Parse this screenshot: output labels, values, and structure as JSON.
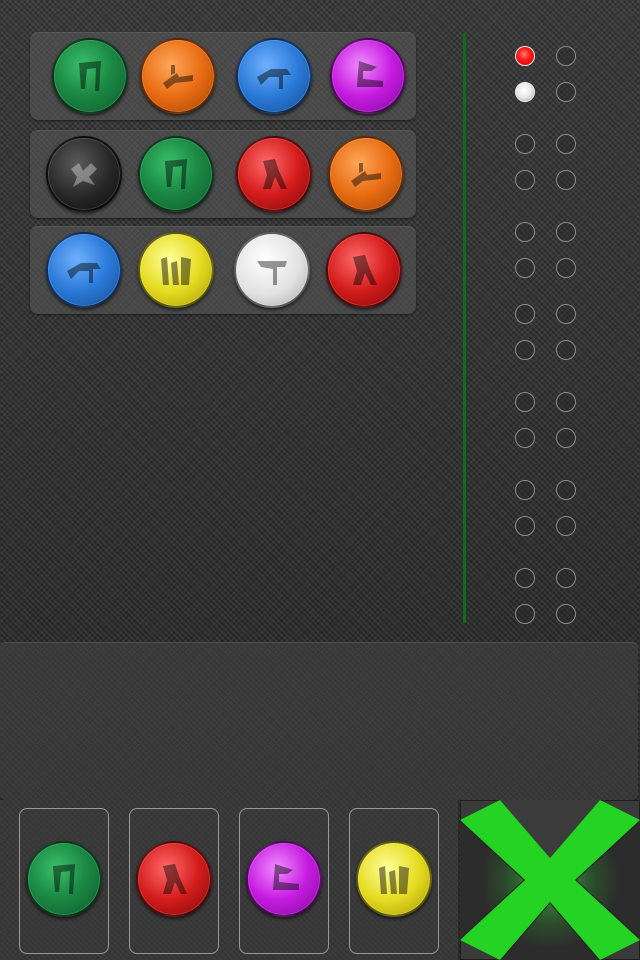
{
  "colors": {
    "green": "#1c8a45",
    "orange": "#e86c12",
    "blue": "#2a7ad8",
    "purple": "#c51be0",
    "black": "#262626",
    "red": "#d41c1c",
    "yellow": "#e6dc22",
    "white": "#e2e2e2",
    "divider": "#0b6e16",
    "clear_x": "#22ee22"
  },
  "guess_rows": [
    {
      "balls": [
        {
          "color": "green",
          "symbol": "glyph-green-icon"
        },
        {
          "color": "orange",
          "symbol": "glyph-orange-icon"
        },
        {
          "color": "blue",
          "symbol": "glyph-blue-icon"
        },
        {
          "color": "purple",
          "symbol": "glyph-purple-icon"
        }
      ]
    },
    {
      "balls": [
        {
          "color": "black",
          "symbol": "glyph-black-icon"
        },
        {
          "color": "green",
          "symbol": "glyph-green-icon"
        },
        {
          "color": "red",
          "symbol": "glyph-red-icon"
        },
        {
          "color": "orange",
          "symbol": "glyph-orange-icon"
        }
      ]
    },
    {
      "balls": [
        {
          "color": "blue",
          "symbol": "glyph-blue-icon"
        },
        {
          "color": "yellow",
          "symbol": "glyph-yellow-icon"
        },
        {
          "color": "white",
          "symbol": "glyph-white-icon"
        },
        {
          "color": "red",
          "symbol": "glyph-red-icon"
        }
      ]
    }
  ],
  "feedback_pegs": [
    [
      "red",
      "empty",
      "white",
      "empty"
    ],
    [
      "empty",
      "empty",
      "empty",
      "empty"
    ],
    [
      "empty",
      "empty",
      "empty",
      "empty"
    ],
    [
      "empty",
      "empty",
      "empty",
      "empty"
    ],
    [
      "empty",
      "empty",
      "empty",
      "empty"
    ],
    [
      "empty",
      "empty",
      "empty",
      "empty"
    ],
    [
      "empty",
      "empty",
      "empty",
      "empty"
    ]
  ],
  "message": {
    "text": ""
  },
  "current_selection": [
    {
      "color": "green",
      "symbol": "glyph-green-icon"
    },
    {
      "color": "red",
      "symbol": "glyph-red-icon"
    },
    {
      "color": "purple",
      "symbol": "glyph-purple-icon"
    },
    {
      "color": "yellow",
      "symbol": "glyph-yellow-icon"
    }
  ],
  "clear_button": {
    "icon": "clear-x-icon"
  }
}
